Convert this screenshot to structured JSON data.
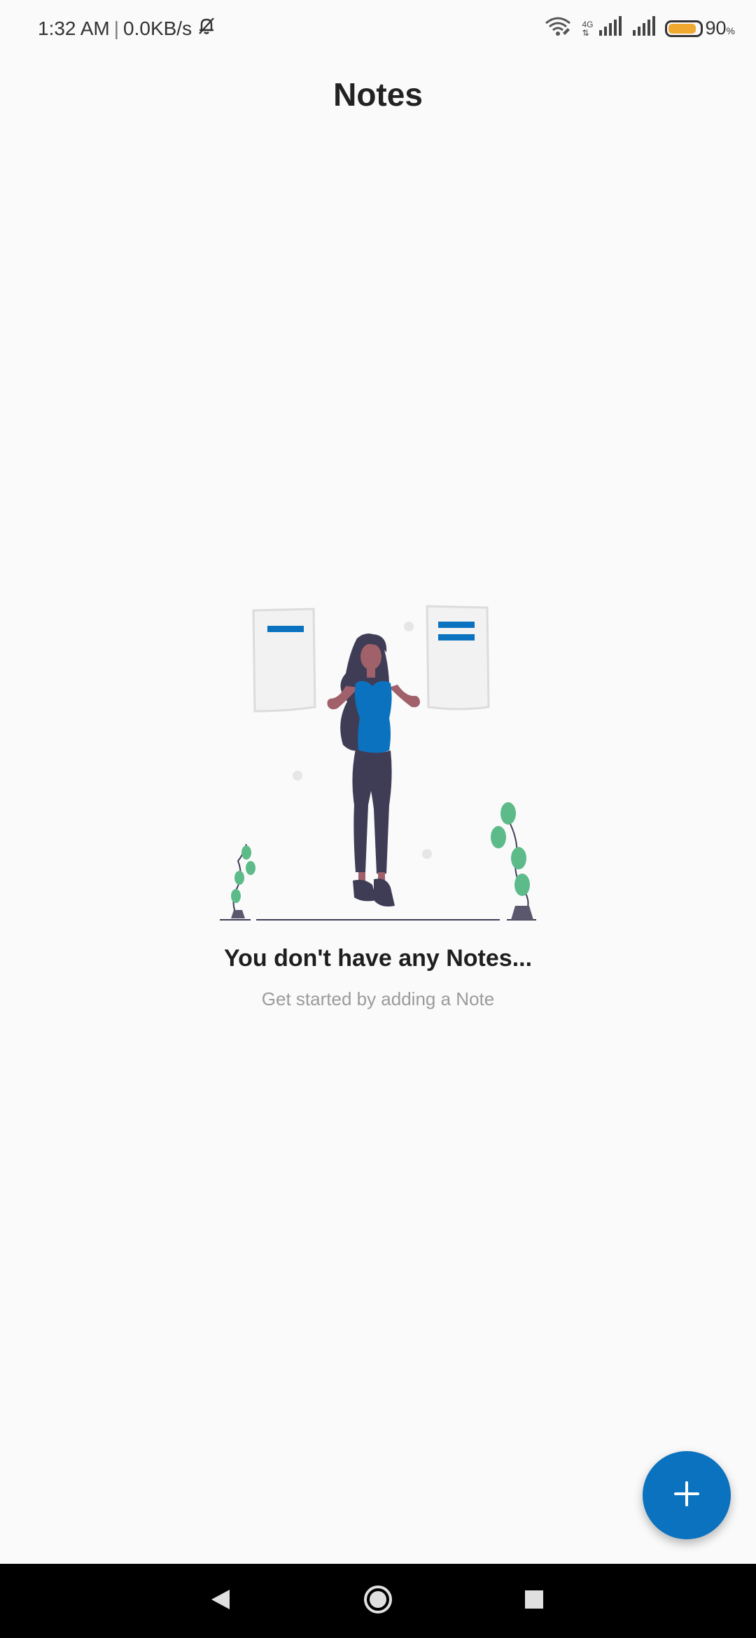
{
  "status_bar": {
    "time": "1:32 AM",
    "separator": "|",
    "net_speed": "0.0KB/s",
    "network_type": "4G",
    "battery_level": "90",
    "battery_unit": "%",
    "battery_fraction": 0.9,
    "battery_color": "#f0a830"
  },
  "app_bar": {
    "title": "Notes"
  },
  "empty_state": {
    "title": "You don't have any Notes...",
    "subtitle": "Get started by adding a Note"
  },
  "fab": {
    "icon": "plus-icon",
    "color": "#0a72bf"
  },
  "nav_bar": {
    "buttons": [
      "back-icon",
      "home-icon",
      "recents-icon"
    ]
  },
  "colors": {
    "accent": "#0a72bf",
    "background": "#fafafa",
    "plant": "#5dbb8a"
  }
}
